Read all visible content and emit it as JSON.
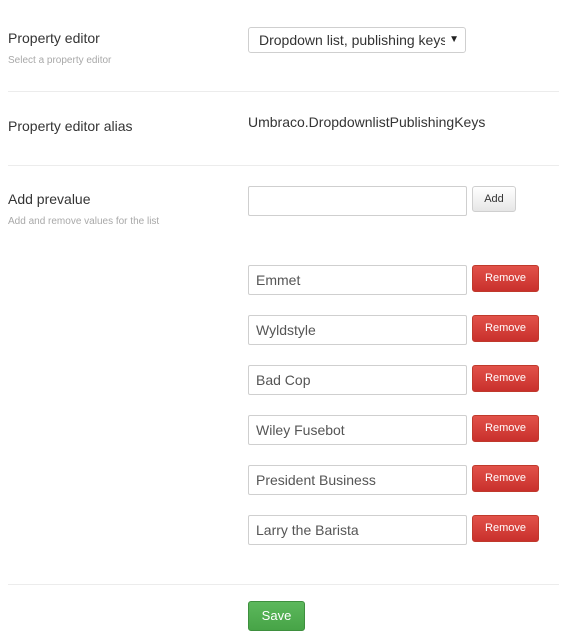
{
  "property_editor": {
    "label": "Property editor",
    "description": "Select a property editor",
    "selected": "Dropdown list, publishing keys"
  },
  "alias": {
    "label": "Property editor alias",
    "value": "Umbraco.DropdownlistPublishingKeys"
  },
  "prevalue": {
    "label": "Add prevalue",
    "description": "Add and remove values for the list",
    "input_value": "",
    "add_label": "Add",
    "remove_label": "Remove",
    "items": [
      "Emmet",
      "Wyldstyle",
      "Bad Cop",
      "Wiley Fusebot",
      "President Business",
      "Larry the Barista"
    ]
  },
  "save_label": "Save"
}
